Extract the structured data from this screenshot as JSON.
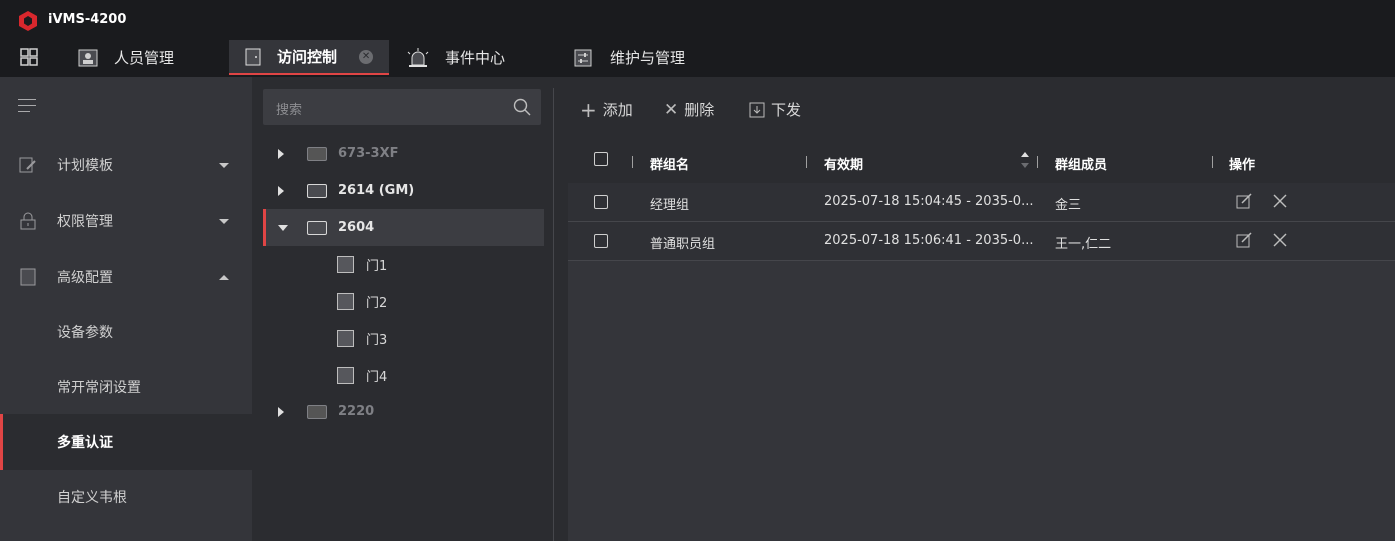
{
  "app": {
    "title": "iVMS-4200",
    "accent": "#e04545"
  },
  "tabs": [
    {
      "label": "人员管理",
      "icon": "person-card-icon",
      "active": false
    },
    {
      "label": "访问控制",
      "icon": "door-icon",
      "active": true
    },
    {
      "label": "事件中心",
      "icon": "alarm-light-icon",
      "active": false
    },
    {
      "label": "维护与管理",
      "icon": "maintenance-icon",
      "active": false
    }
  ],
  "sidebar": {
    "items": [
      {
        "label": "计划模板",
        "icon": "template-edit-icon",
        "expanded": false
      },
      {
        "label": "权限管理",
        "icon": "lock-icon",
        "expanded": false
      },
      {
        "label": "高级配置",
        "icon": "config-doc-icon",
        "expanded": true
      }
    ],
    "subitems": [
      {
        "label": "设备参数"
      },
      {
        "label": "常开常闭设置"
      },
      {
        "label": "多重认证",
        "selected": true
      },
      {
        "label": "自定义韦根"
      }
    ]
  },
  "tree": {
    "search_placeholder": "搜索",
    "devices": [
      {
        "name": "673-3XF",
        "online": false
      },
      {
        "name": "2614 (GM)",
        "online": true
      },
      {
        "name": "2604",
        "online": true,
        "expanded": true,
        "selected": true
      },
      {
        "name": "2220",
        "online": false
      }
    ],
    "doors": [
      "门1",
      "门2",
      "门3",
      "门4"
    ]
  },
  "toolbar": {
    "add": "添加",
    "delete": "删除",
    "apply": "下发"
  },
  "table": {
    "columns": [
      "群组名",
      "有效期",
      "群组成员",
      "操作"
    ],
    "rows": [
      {
        "name": "经理组",
        "validity": "2025-07-18 15:04:45 - 2035-0...",
        "members": "金三"
      },
      {
        "name": "普通职员组",
        "validity": "2025-07-18 15:06:41 - 2035-0...",
        "members": "王一,仁二"
      }
    ]
  }
}
